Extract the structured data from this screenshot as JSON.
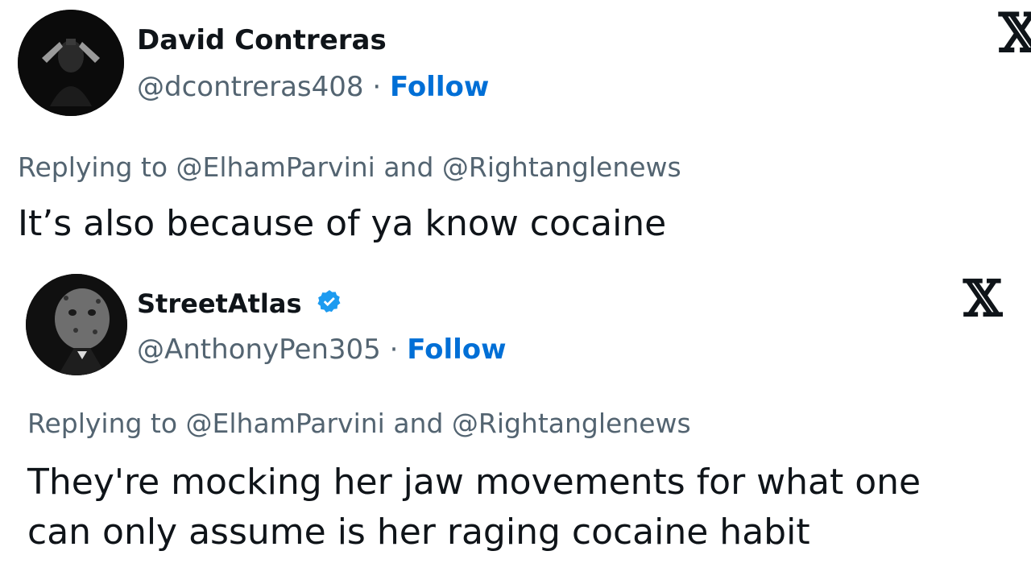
{
  "tweets": [
    {
      "display_name": "David Contreras",
      "handle": "@dcontreras408",
      "separator": "·",
      "follow_label": "Follow",
      "verified": false,
      "replying_to": "Replying to @ElhamParvini and @Rightanglenews",
      "text": "It’s also because of ya know cocaine",
      "platform_icon": "x-logo-icon"
    },
    {
      "display_name": "StreetAtlas",
      "handle": "@AnthonyPen305",
      "separator": "·",
      "follow_label": "Follow",
      "verified": true,
      "replying_to": "Replying to @ElhamParvini and @Rightanglenews",
      "text_line1": "They're mocking her jaw movements for what one",
      "text_line2": "can only assume is her raging cocaine habit",
      "platform_icon": "x-logo-icon"
    }
  ],
  "colors": {
    "text_primary": "#0f1419",
    "text_secondary": "#536471",
    "follow": "#006fd6",
    "verified_badge": "#1d9bf0"
  }
}
